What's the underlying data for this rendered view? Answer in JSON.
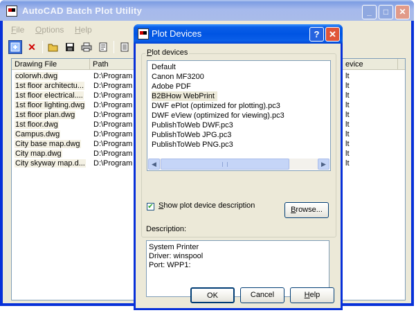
{
  "main": {
    "title": "AutoCAD Batch Plot Utility",
    "menu": [
      {
        "underline": "F",
        "rest": "ile"
      },
      {
        "underline": "O",
        "rest": "ptions"
      },
      {
        "underline": "H",
        "rest": "elp"
      }
    ],
    "columns": [
      "Drawing File",
      "Path",
      "evice"
    ],
    "rows": [
      {
        "file": "colorwh.dwg",
        "path": "D:\\Program Files",
        "device": "lt"
      },
      {
        "file": "1st floor architectu...",
        "path": "D:\\Program Files",
        "device": "lt"
      },
      {
        "file": "1st floor electrical....",
        "path": "D:\\Program Files",
        "device": "lt"
      },
      {
        "file": "1st floor lighting.dwg",
        "path": "D:\\Program Files",
        "device": "lt"
      },
      {
        "file": "1st floor plan.dwg",
        "path": "D:\\Program Files",
        "device": "lt"
      },
      {
        "file": "1st floor.dwg",
        "path": "D:\\Program Files",
        "device": "lt"
      },
      {
        "file": "Campus.dwg",
        "path": "D:\\Program Files",
        "device": "lt"
      },
      {
        "file": "City base map.dwg",
        "path": "D:\\Program Files",
        "device": "lt"
      },
      {
        "file": "City map.dwg",
        "path": "D:\\Program Files",
        "device": "lt"
      },
      {
        "file": "City skyway map.d...",
        "path": "D:\\Program Files",
        "device": "lt"
      }
    ]
  },
  "dialog": {
    "title": "Plot Devices",
    "group_label_u": "P",
    "group_label_rest": "lot devices",
    "devices": [
      "Default",
      "Canon MF3200",
      "Adobe PDF",
      "B2BHow WebPrint",
      "DWF ePlot (optimized for plotting).pc3",
      "DWF eView (optimized for viewing).pc3",
      "PublishToWeb DWF.pc3",
      "PublishToWeb JPG.pc3",
      "PublishToWeb PNG.pc3"
    ],
    "selected_device": "B2BHow WebPrint",
    "show_desc_u": "S",
    "show_desc_rest": "how plot device description",
    "show_desc_checked": true,
    "browse_u": "B",
    "browse_rest": "rowse...",
    "description_label": "Description:",
    "description_lines": [
      "System Printer",
      "Driver: winspool",
      "Port: WPP1:"
    ],
    "ok_label": "OK",
    "cancel_label": "Cancel",
    "help_u": "H",
    "help_rest": "elp"
  }
}
